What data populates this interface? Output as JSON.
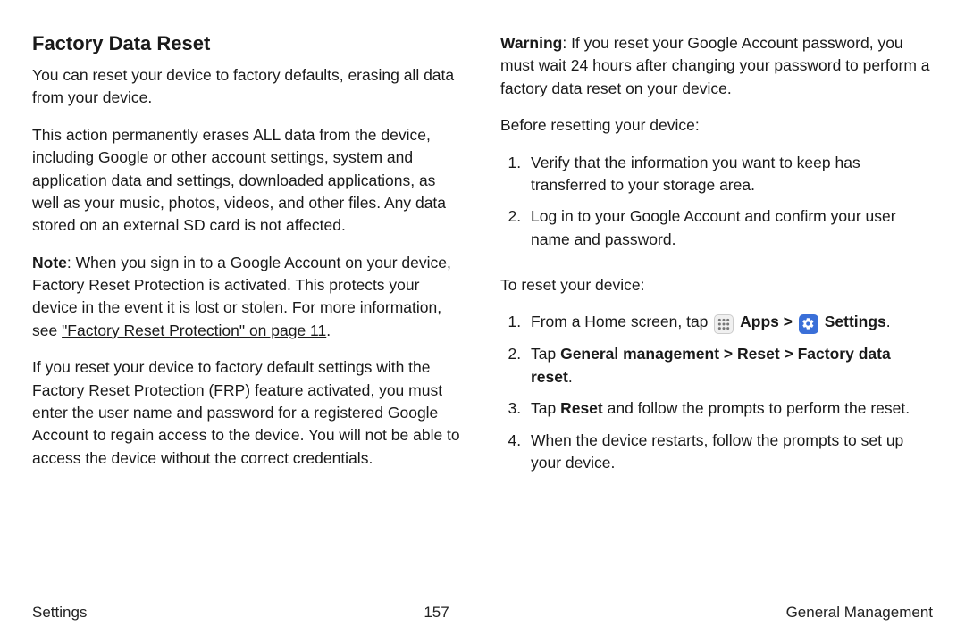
{
  "left": {
    "heading": "Factory Data Reset",
    "p1": "You can reset your device to factory defaults, erasing all data from your device.",
    "p2": "This action permanently erases ALL data from the device, including Google or other account settings, system and application data and settings, downloaded applications, as well as your music, photos, videos, and other files. Any data stored on an external SD card is not affected.",
    "note_label": "Note",
    "note_body": ": When you sign in to a Google Account on your device, Factory Reset Protection is activated. This protects your device in the event it is lost or stolen. For more information, see ",
    "note_link": "\"Factory Reset Protection\" on page 11",
    "note_after": ".",
    "p4": "If you reset your device to factory default settings with the Factory Reset Protection (FRP) feature activated, you must enter the user name and password for a registered Google Account to regain access to the device. You will not be able to access the device without the correct credentials."
  },
  "right": {
    "warn_label": "Warning",
    "warn_body": ": If you reset your Google Account password, you must wait 24 hours after changing your password to perform a factory data reset on your device.",
    "before": "Before resetting your device:",
    "before_list": [
      "Verify that the information you want to keep has transferred to your storage area.",
      "Log in to your Google Account and confirm your user name and password."
    ],
    "toreset": "To reset your device:",
    "step1_a": "From a Home screen, tap ",
    "step1_apps": "Apps",
    "step1_gt": " > ",
    "step1_settings": "Settings",
    "step1_end": ".",
    "step2_a": "Tap ",
    "step2_b": "General management > Reset > Factory data reset",
    "step2_end": ".",
    "step3_a": "Tap ",
    "step3_b": "Reset",
    "step3_c": " and follow the prompts to perform the reset.",
    "step4": "When the device restarts, follow the prompts to set up your device."
  },
  "footer": {
    "left": "Settings",
    "center": "157",
    "right": "General Management"
  }
}
